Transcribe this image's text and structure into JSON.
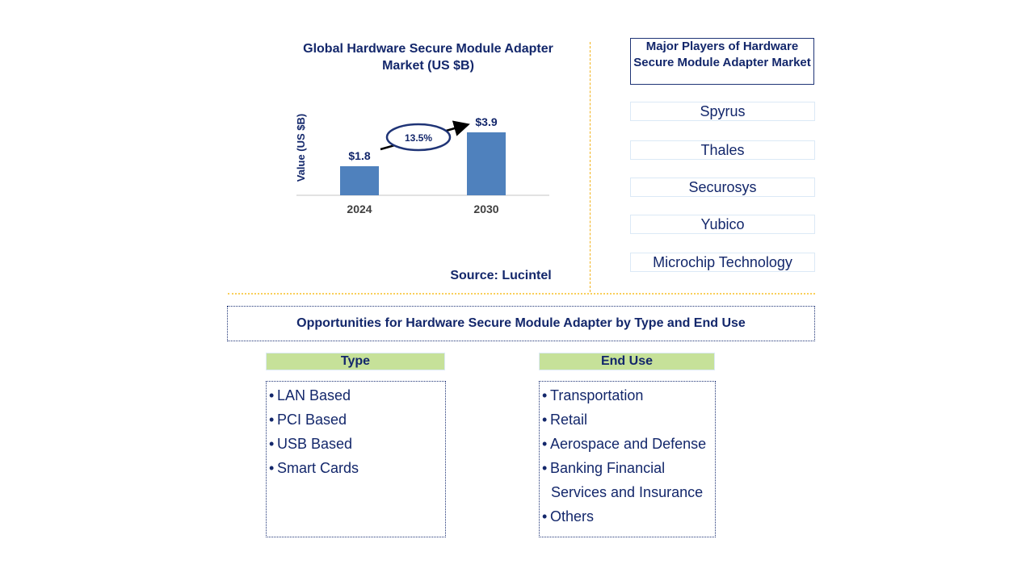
{
  "chart_data": {
    "type": "bar",
    "title": "Global Hardware Secure Module Adapter Market (US $B)",
    "categories": [
      "2024",
      "2030"
    ],
    "values": [
      1.8,
      3.9
    ],
    "data_labels": [
      "$1.8",
      "$3.9"
    ],
    "ylabel": "Value (US $B)",
    "xlabel": "",
    "ylim": [
      0,
      4.5
    ],
    "grid": false,
    "annotation": {
      "text": "13.5%",
      "meaning": "CAGR 2024-2030"
    },
    "bar_color": "#4f81bd",
    "source": "Source: Lucintel"
  },
  "players": {
    "title": "Major Players of Hardware Secure Module Adapter Market",
    "items": [
      "Spyrus",
      "Thales",
      "Securosys",
      "Yubico",
      "Microchip Technology"
    ]
  },
  "opportunities": {
    "title": "Opportunities for Hardware Secure Module Adapter by Type and End Use",
    "type": {
      "heading": "Type",
      "items": [
        "LAN Based",
        "PCI Based",
        "USB Based",
        "Smart Cards"
      ]
    },
    "end_use": {
      "heading": "End Use",
      "items": [
        "Transportation",
        "Retail",
        "Aerospace and Defense",
        "Banking Financial",
        "Services and Insurance",
        "Others"
      ]
    }
  },
  "colors": {
    "text": "#13276b",
    "bar": "#4f81bd",
    "divider": "#f2b21b",
    "category_header": "#c6e199"
  }
}
